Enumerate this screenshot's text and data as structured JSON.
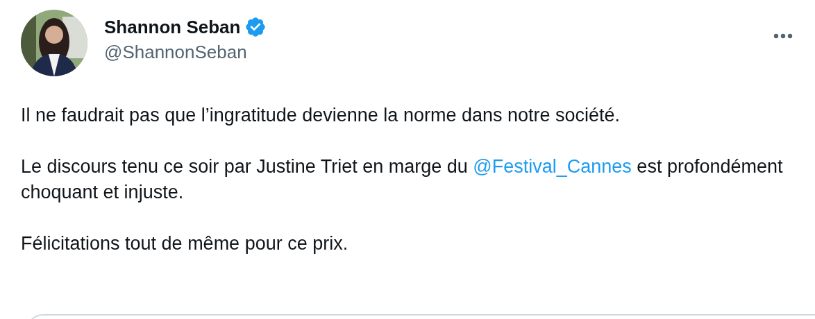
{
  "author": {
    "name": "Shannon Seban",
    "verified": true,
    "handle": "@ShannonSeban"
  },
  "paragraphs": [
    {
      "text": "Il ne faudrait pas que l’ingratitude devienne la norme dans notre société."
    },
    {
      "text": "Le discours tenu ce soir par Justine Triet en marge du ",
      "mention": "@Festival_Cannes",
      "text_after": " est profondément choquant et injuste."
    },
    {
      "text": "Félicitations tout de même pour ce prix."
    }
  ]
}
